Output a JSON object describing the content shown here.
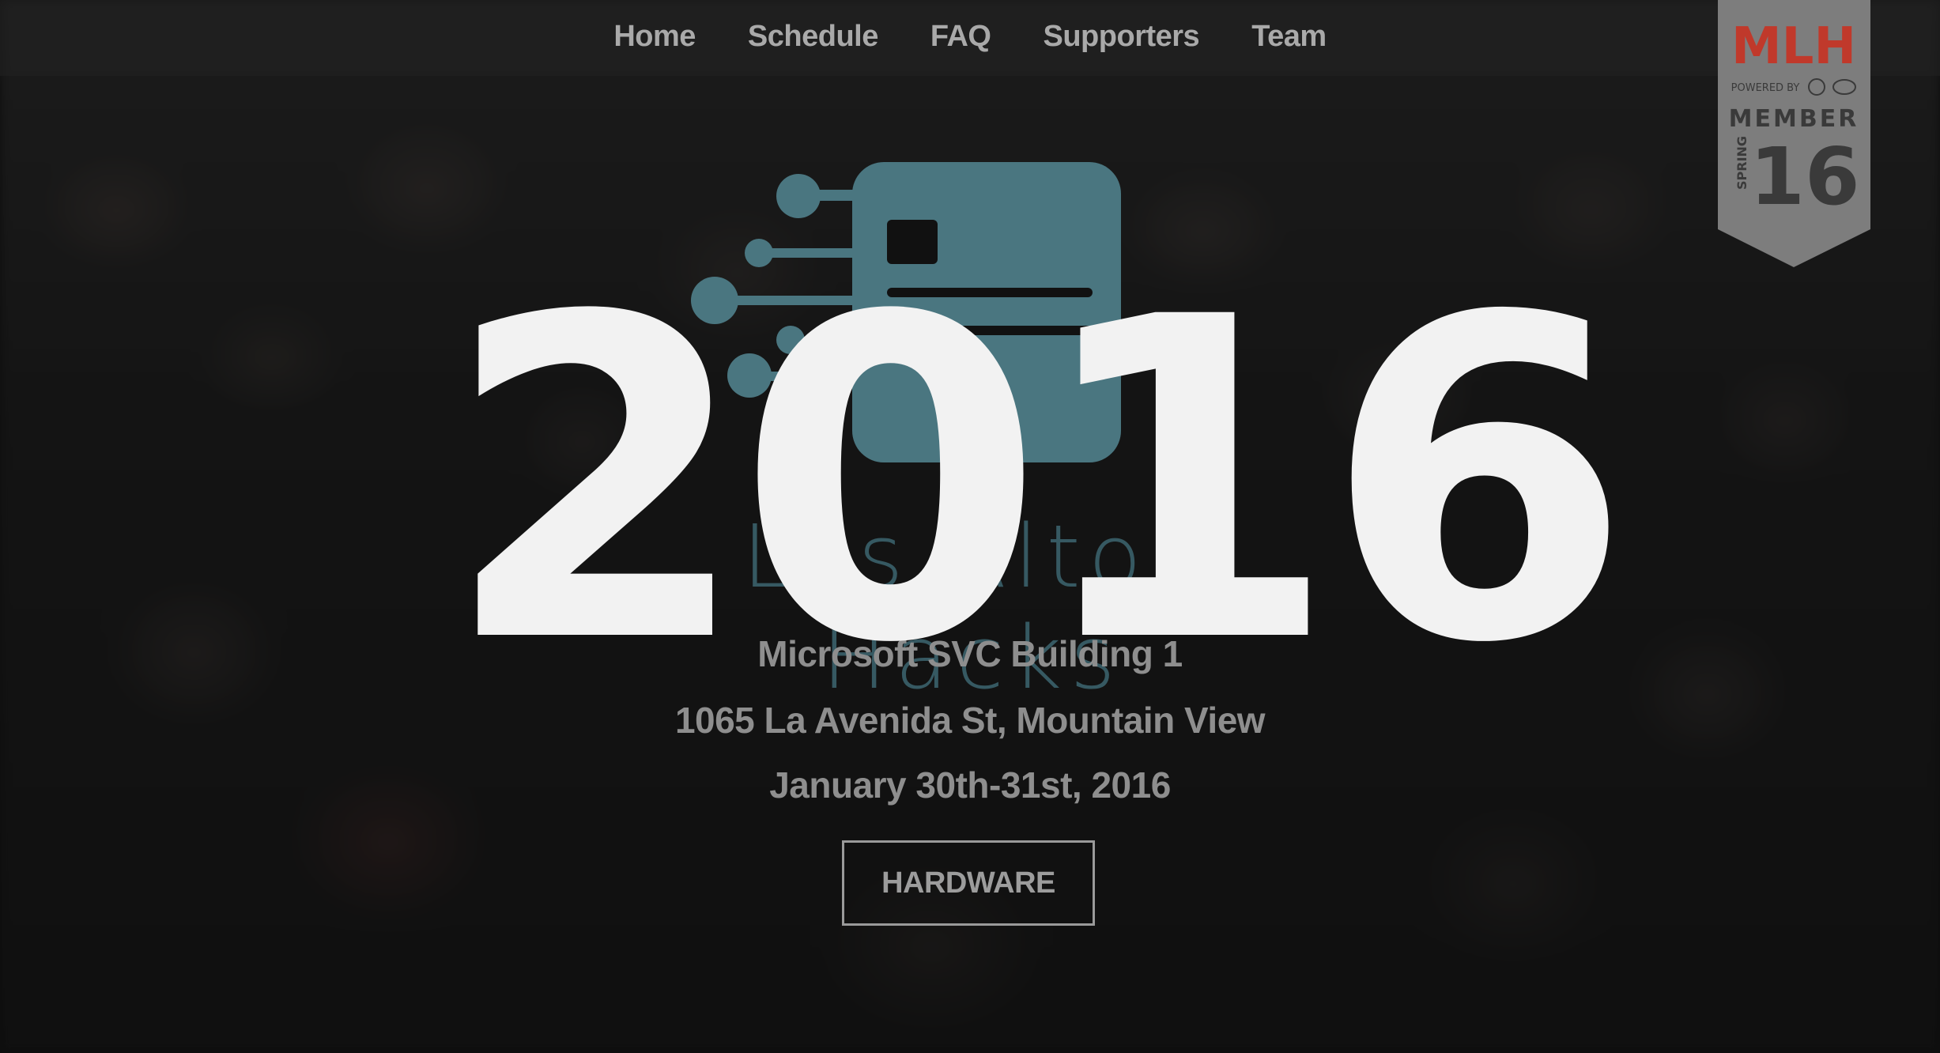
{
  "nav": {
    "items": [
      {
        "label": "Home"
      },
      {
        "label": "Schedule"
      },
      {
        "label": "FAQ"
      },
      {
        "label": "Supporters"
      },
      {
        "label": "Team"
      }
    ]
  },
  "badge": {
    "brand": "MLH",
    "powered_by": "POWERED BY",
    "member": "MEMBER",
    "season": "SPRING",
    "year": "16"
  },
  "hero": {
    "logo_text": "Los Altos Hacks",
    "overlay_year": "2016",
    "venue": "Microsoft SVC Building 1",
    "address": "1065 La Avenida St, Mountain View",
    "dates": "January 30th-31st, 2016",
    "button_label": "HARDWARE"
  },
  "colors": {
    "logo_teal": "#4a7680",
    "nav_text": "#a9a9a9",
    "overlay_text": "#f2f2f2",
    "mlh_red": "#c0392b",
    "mlh_blue": "#1e73be",
    "mlh_yellow": "#e6b12b"
  }
}
